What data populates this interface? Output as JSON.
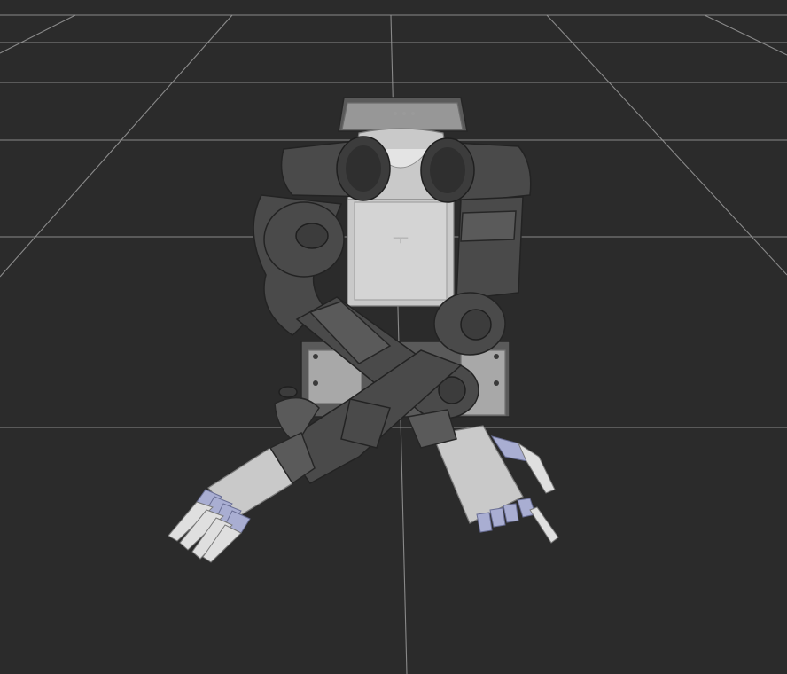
{
  "viewport": {
    "background": "#2b2b2b",
    "grid_color": "#9a9a9a",
    "robot_dark": "#4a4a4a",
    "robot_light": "#c9c9c9",
    "finger_joint": "#a9aed2"
  }
}
